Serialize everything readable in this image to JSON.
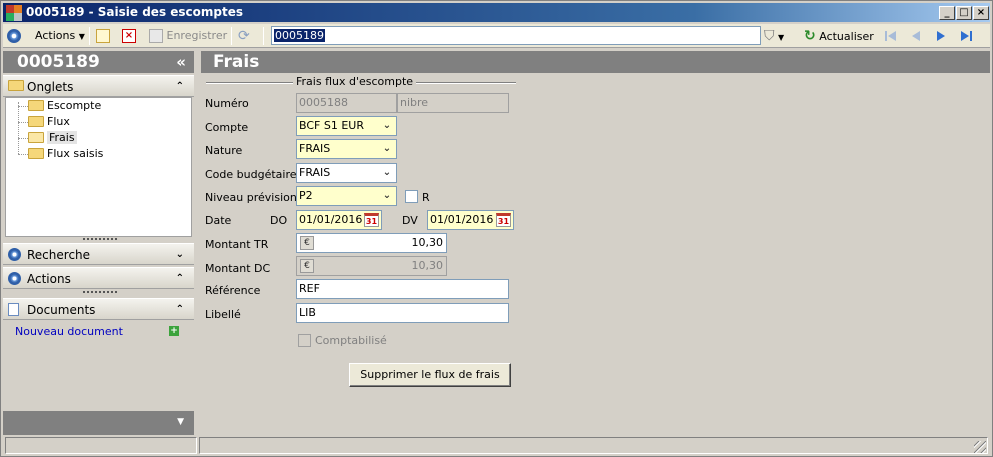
{
  "window": {
    "title": "0005189 -  Saisie des escomptes"
  },
  "toolbar": {
    "actions_label": "Actions",
    "save_label": "Enregistrer",
    "search_value": "0005189",
    "refresh_label": "Actualiser"
  },
  "left": {
    "header": "0005189",
    "collapse_glyph": "«",
    "onglets_label": "Onglets",
    "tree": [
      {
        "label": "Escompte"
      },
      {
        "label": "Flux"
      },
      {
        "label": "Frais"
      },
      {
        "label": "Flux saisis"
      }
    ],
    "recherche_label": "Recherche",
    "actions_label": "Actions",
    "documents_label": "Documents",
    "new_document_label": "Nouveau document"
  },
  "main": {
    "header": "Frais",
    "group_title": "Frais flux d'escompte",
    "labels": {
      "numero": "Numéro",
      "compte": "Compte",
      "nature": "Nature",
      "code_budgetaire": "Code budgétaire",
      "niveau_prevision": "Niveau prévision",
      "date": "Date",
      "do": "DO",
      "dv": "DV",
      "montant_tr": "Montant TR",
      "montant_dc": "Montant DC",
      "reference": "Référence",
      "libelle": "Libellé",
      "r": "R",
      "comptabilise": "Comptabilisé"
    },
    "values": {
      "numero": "0005188",
      "numero_suffix": "nibre",
      "compte": "BCF S1 EUR",
      "nature": "FRAIS",
      "code_budgetaire": "FRAIS",
      "niveau_prevision": "P2",
      "date_do": "01/01/2016",
      "date_dv": "01/01/2016",
      "montant_tr": "10,30",
      "montant_dc": "10,30",
      "currency_symbol": "€",
      "reference": "REF",
      "libelle": "LIB",
      "calendar_glyph": "31"
    },
    "delete_button_label": "Supprimer le flux de frais"
  },
  "colors": {
    "title_gradient_start": "#0a246a",
    "panel_header": "#808080",
    "required_field": "#ffffcc",
    "link": "#0000c0"
  }
}
